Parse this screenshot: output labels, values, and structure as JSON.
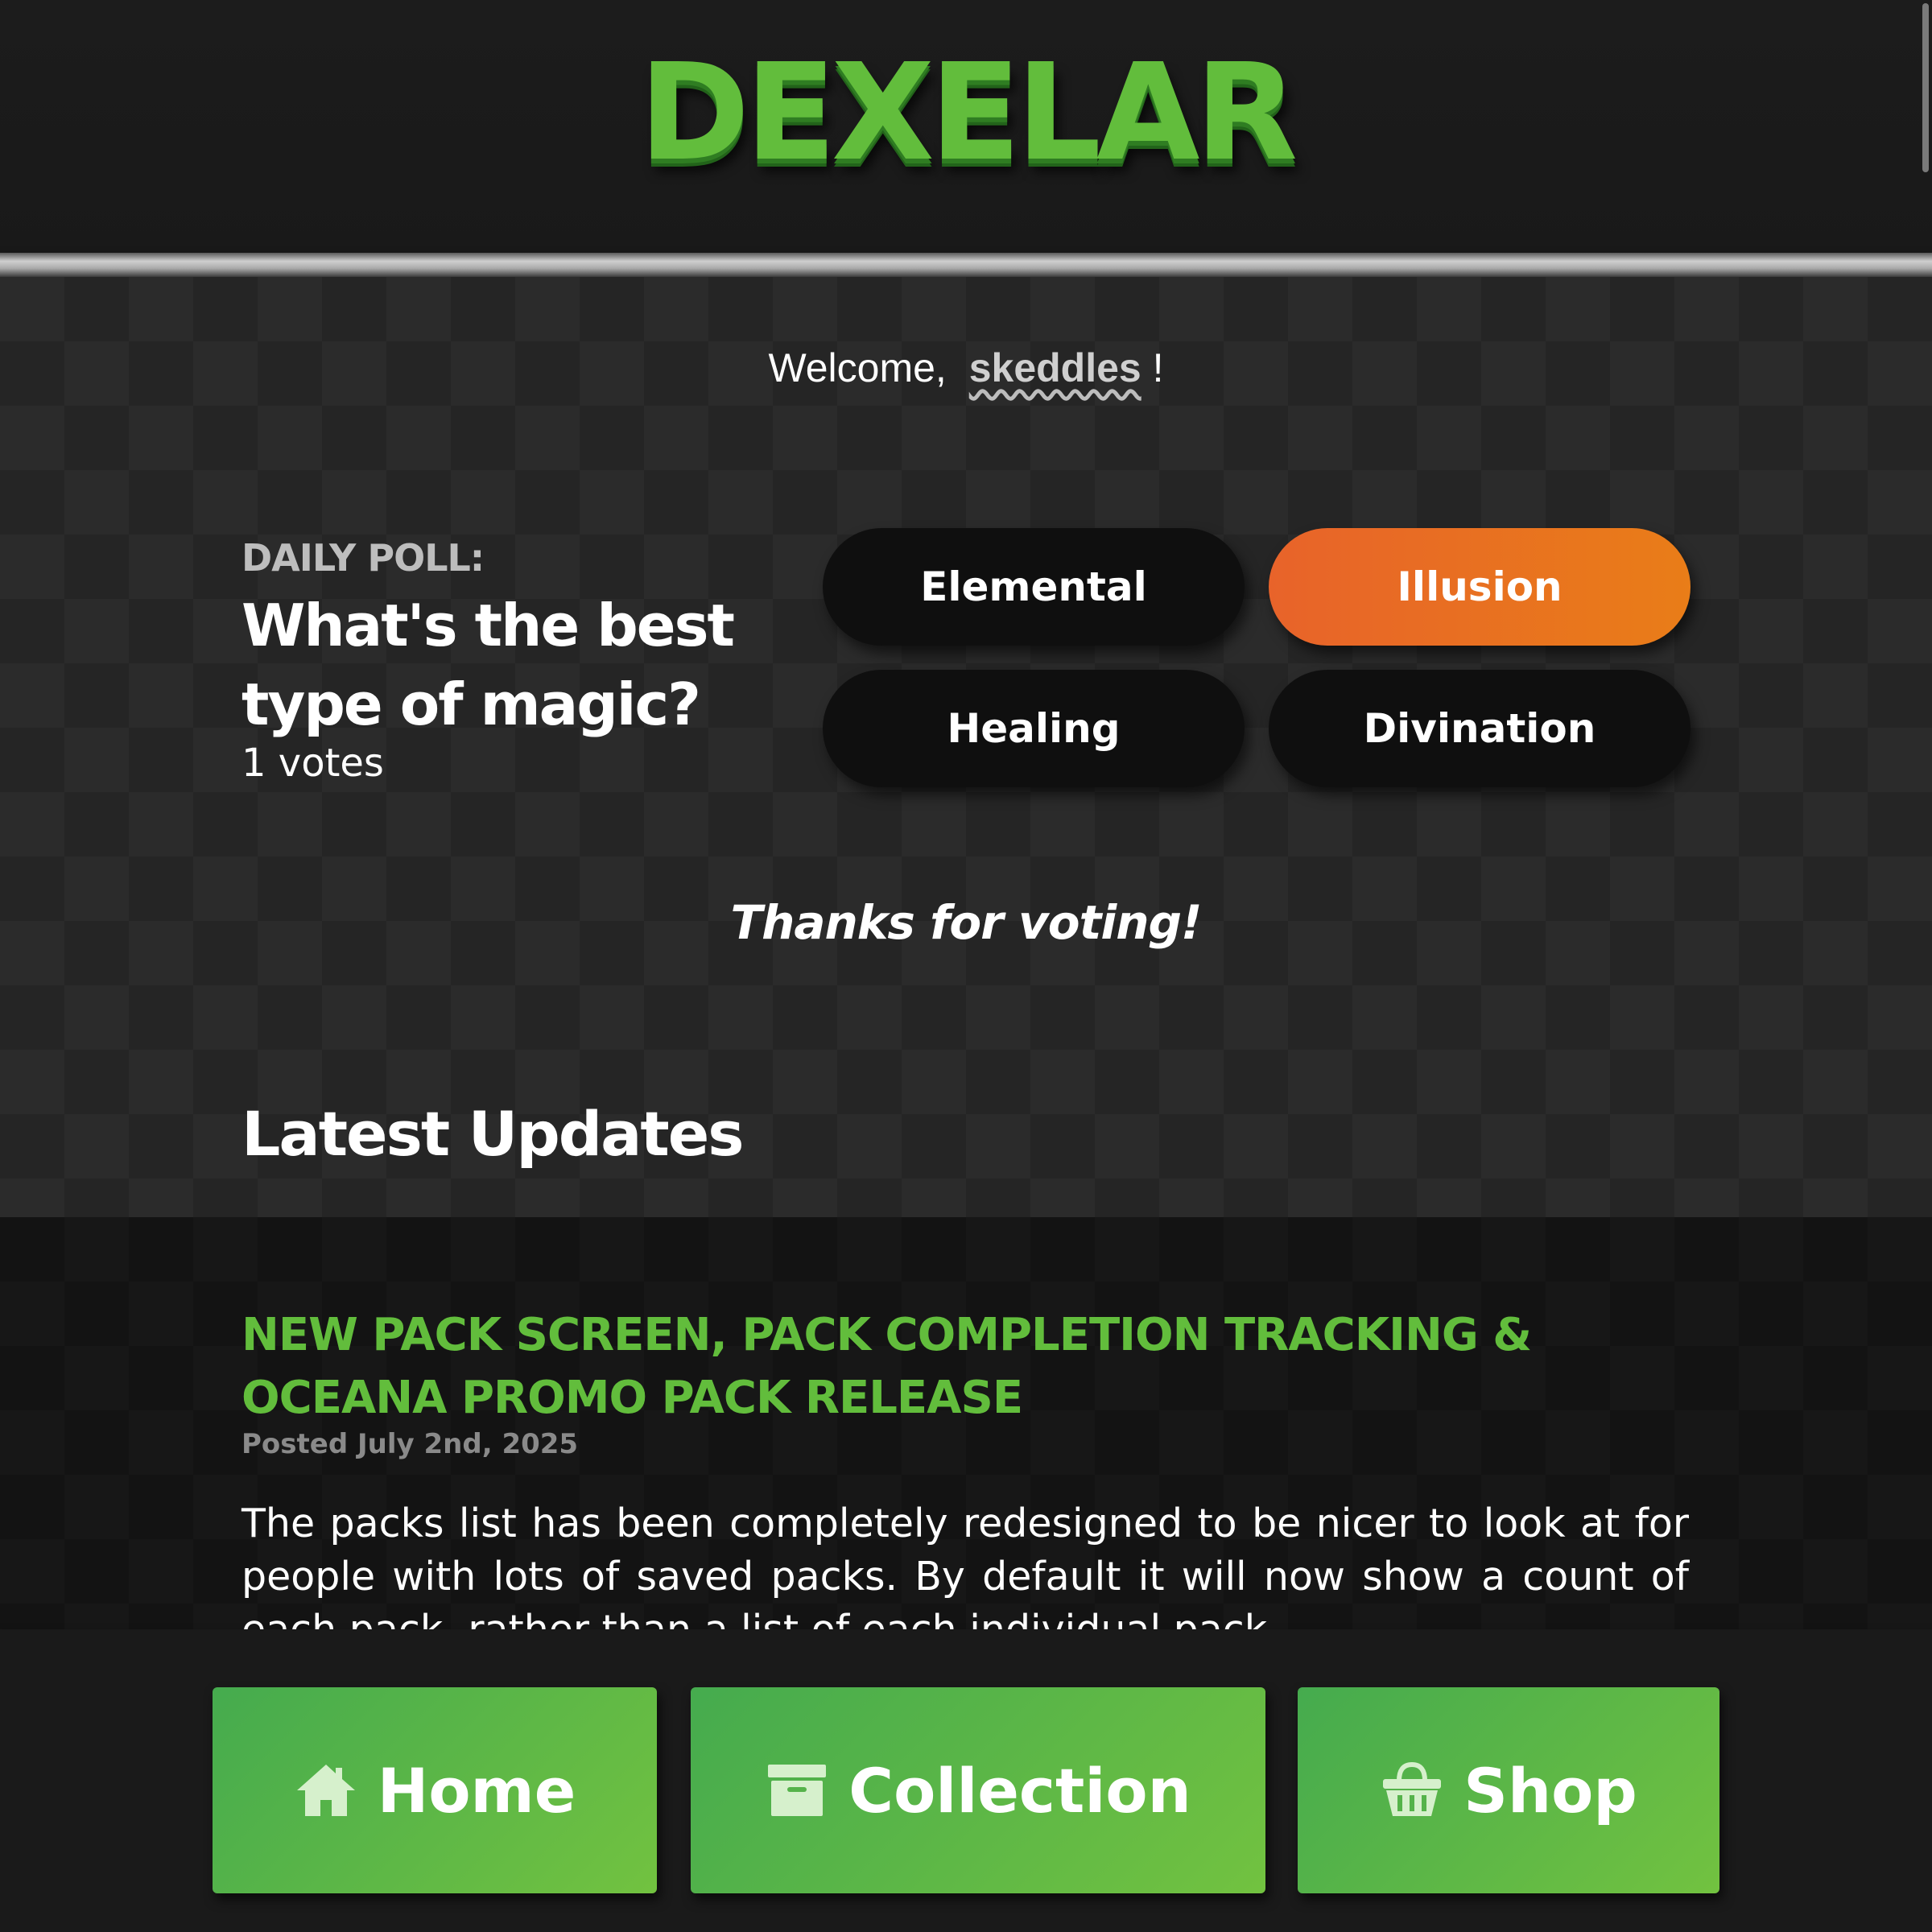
{
  "header": {
    "logo_text": "DEXELAR"
  },
  "welcome": {
    "prefix": "Welcome,",
    "username": "skeddles",
    "suffix": "!"
  },
  "poll": {
    "label": "DAILY POLL:",
    "question": "What's the best type of magic?",
    "votes_text": "1 votes",
    "options": [
      {
        "label": "Elemental",
        "selected": false
      },
      {
        "label": "Illusion",
        "selected": true
      },
      {
        "label": "Healing",
        "selected": false
      },
      {
        "label": "Divination",
        "selected": false
      }
    ],
    "thanks_text": "Thanks for voting!"
  },
  "updates": {
    "section_title": "Latest Updates",
    "items": [
      {
        "title": "NEW PACK SCREEN, PACK COMPLETION TRACKING & OCEANA PROMO PACK RELEASE",
        "date": "Posted July 2nd, 2025",
        "body": "The packs list has been completely redesigned to be nicer to look at for people with lots of saved packs. By default it will now show a count of each pack, rather than a list of each individual pack."
      }
    ]
  },
  "nav": {
    "home_label": "Home",
    "home_icon": "home-icon",
    "collection_label": "Collection",
    "collection_icon": "archive-box-icon",
    "shop_label": "Shop",
    "shop_icon": "basket-icon"
  },
  "colors": {
    "brand_green": "#62bd3c",
    "selected_orange": "#e8632a",
    "button_green": "#45ab4e"
  }
}
